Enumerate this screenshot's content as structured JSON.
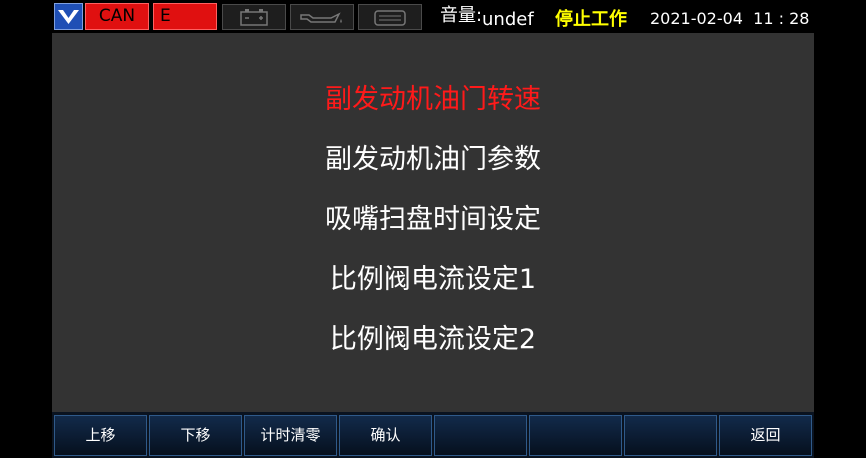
{
  "status_bar": {
    "can_label": "CAN",
    "error_label": "E",
    "volume_label": "音量:",
    "volume_value": "undef",
    "run_status": "停止工作",
    "datetime": "2021-02-04  11 : 28",
    "icons": [
      "battery-icon",
      "oil-pressure-icon",
      "engine-icon"
    ]
  },
  "menu": {
    "items": [
      {
        "label": "副发动机油门转速",
        "selected": true
      },
      {
        "label": "副发动机油门参数",
        "selected": false
      },
      {
        "label": "吸嘴扫盘时间设定",
        "selected": false
      },
      {
        "label": "比例阀电流设定1",
        "selected": false
      },
      {
        "label": "比例阀电流设定2",
        "selected": false
      }
    ]
  },
  "softkeys": [
    "上移",
    "下移",
    "计时清零",
    "确认",
    "",
    "",
    "",
    "返回"
  ],
  "colors": {
    "selected_text": "#ff1a1a",
    "normal_text": "#ffffff",
    "status_text": "#ffff00",
    "alarm": "#e01010",
    "background": "#333333"
  }
}
